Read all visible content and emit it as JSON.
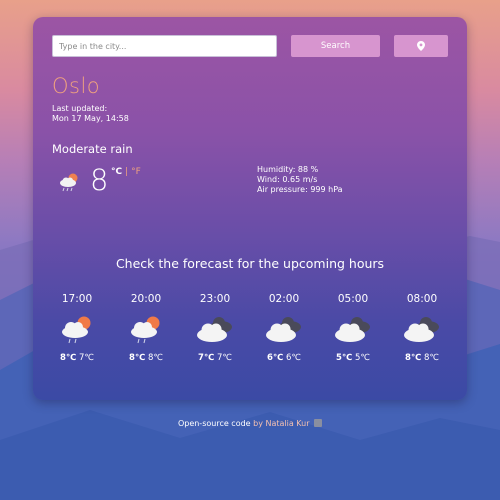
{
  "search": {
    "placeholder": "Type in the city...",
    "button_label": "Search",
    "location_icon": "map-marker-icon"
  },
  "current": {
    "city": "Oslo",
    "updated_label": "Last updated:",
    "updated_time": "Mon 17 May, 14:58",
    "description": "Moderate rain",
    "icon": "partly-cloudy-rain-icon",
    "temperature": "8",
    "unit_c": "°C",
    "unit_sep": "|",
    "unit_f": "°F",
    "humidity": "Humidity: 88 %",
    "wind": "Wind: 0.65 m/s",
    "pressure": "Air pressure: 999 hPa"
  },
  "forecast": {
    "title": "Check the forecast for the upcoming hours",
    "hours": [
      {
        "time": "17:00",
        "icon": "sun-cloud-rain-icon",
        "max": "8℃",
        "min": "7℃"
      },
      {
        "time": "20:00",
        "icon": "sun-cloud-rain-icon",
        "max": "8℃",
        "min": "8℃"
      },
      {
        "time": "23:00",
        "icon": "dark-cloud-icon",
        "max": "7℃",
        "min": "7℃"
      },
      {
        "time": "02:00",
        "icon": "dark-cloud-icon",
        "max": "6℃",
        "min": "6℃"
      },
      {
        "time": "05:00",
        "icon": "dark-cloud-icon",
        "max": "5℃",
        "min": "5℃"
      },
      {
        "time": "08:00",
        "icon": "dark-cloud-icon",
        "max": "8℃",
        "min": "8℃"
      }
    ]
  },
  "footer": {
    "link_text": "Open-source code",
    "by_text": " by Natalia Kur",
    "icon": "github-icon"
  },
  "colors": {
    "accent": "#f0a27e",
    "button": "#d795cf"
  }
}
